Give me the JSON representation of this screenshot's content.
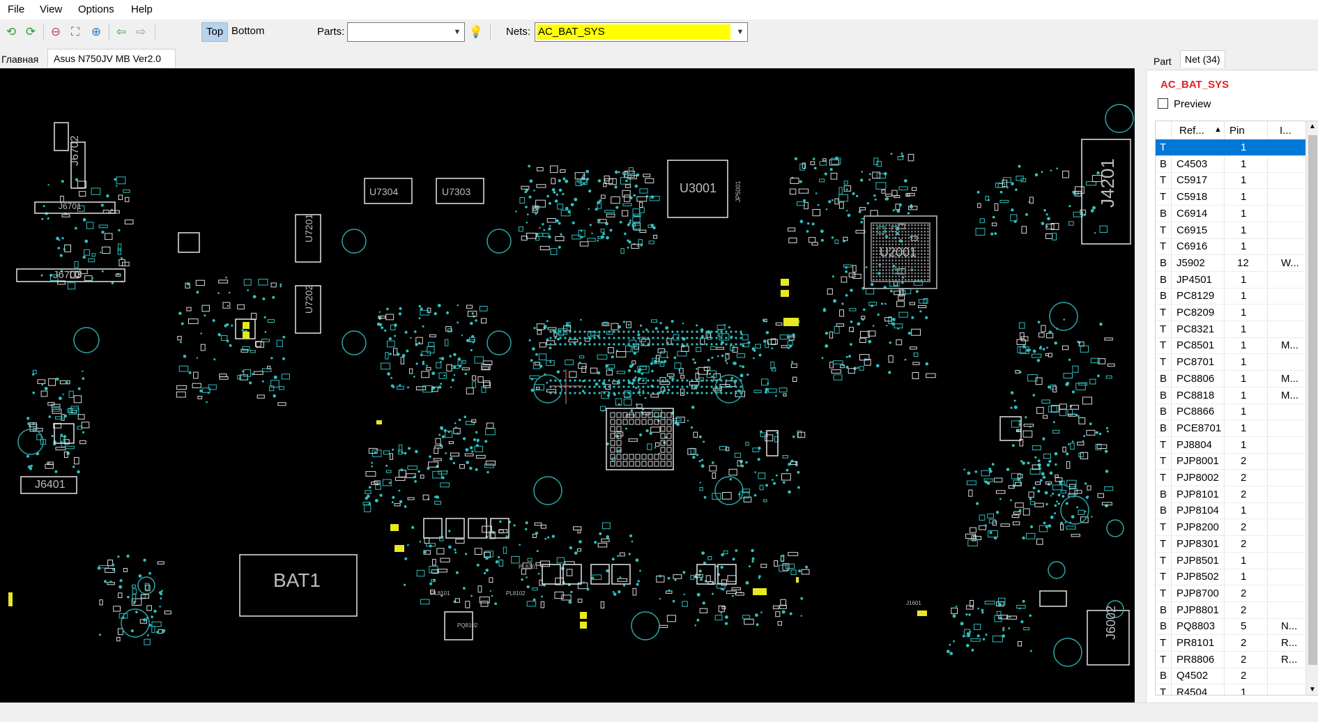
{
  "menu": {
    "items": [
      "File",
      "View",
      "Options",
      "Help"
    ]
  },
  "toolbar": {
    "layers": {
      "top": "Top",
      "bottom": "Bottom",
      "active": "Top"
    },
    "parts_label": "Parts:",
    "parts_value": "",
    "nets_label": "Nets:",
    "nets_value": "AC_BAT_SYS",
    "nets_highlight": "#ffff00"
  },
  "doc_tabs": [
    "Главная",
    "Asus N750JV MB Ver2.0"
  ],
  "board": {
    "labels": [
      "J6702",
      "J6701",
      "J6703",
      "J6401",
      "U7304",
      "U7303",
      "U7201",
      "U7202",
      "U3001",
      "U2001",
      "J4201",
      "BAT1",
      "J6002",
      "JP5001",
      "J1601",
      "PL8101",
      "PL8102",
      "PQ8102",
      "PL8201"
    ],
    "trace_color": "#30c0c0",
    "highlight_color": "#e8e820"
  },
  "panel": {
    "tabs": [
      "Part",
      "Net (34)"
    ],
    "active_tab": "Net (34)",
    "net_title": "AC_BAT_SYS",
    "preview_label": "Preview",
    "columns": [
      "Ref...",
      "Pin",
      "I..."
    ],
    "rows": [
      {
        "side": "T",
        "ref": "",
        "pin": "1",
        "info": ""
      },
      {
        "side": "B",
        "ref": "C4503",
        "pin": "1",
        "info": ""
      },
      {
        "side": "T",
        "ref": "C5917",
        "pin": "1",
        "info": ""
      },
      {
        "side": "T",
        "ref": "C5918",
        "pin": "1",
        "info": ""
      },
      {
        "side": "B",
        "ref": "C6914",
        "pin": "1",
        "info": ""
      },
      {
        "side": "T",
        "ref": "C6915",
        "pin": "1",
        "info": ""
      },
      {
        "side": "T",
        "ref": "C6916",
        "pin": "1",
        "info": ""
      },
      {
        "side": "B",
        "ref": "J5902",
        "pin": "12",
        "info": "W..."
      },
      {
        "side": "B",
        "ref": "JP4501",
        "pin": "1",
        "info": ""
      },
      {
        "side": "B",
        "ref": "PC8129",
        "pin": "1",
        "info": ""
      },
      {
        "side": "T",
        "ref": "PC8209",
        "pin": "1",
        "info": ""
      },
      {
        "side": "T",
        "ref": "PC8321",
        "pin": "1",
        "info": ""
      },
      {
        "side": "T",
        "ref": "PC8501",
        "pin": "1",
        "info": "M..."
      },
      {
        "side": "T",
        "ref": "PC8701",
        "pin": "1",
        "info": ""
      },
      {
        "side": "B",
        "ref": "PC8806",
        "pin": "1",
        "info": "M..."
      },
      {
        "side": "B",
        "ref": "PC8818",
        "pin": "1",
        "info": "M..."
      },
      {
        "side": "B",
        "ref": "PC8866",
        "pin": "1",
        "info": ""
      },
      {
        "side": "B",
        "ref": "PCE8701",
        "pin": "1",
        "info": ""
      },
      {
        "side": "T",
        "ref": "PJ8804",
        "pin": "1",
        "info": ""
      },
      {
        "side": "T",
        "ref": "PJP8001",
        "pin": "2",
        "info": ""
      },
      {
        "side": "T",
        "ref": "PJP8002",
        "pin": "2",
        "info": ""
      },
      {
        "side": "B",
        "ref": "PJP8101",
        "pin": "2",
        "info": ""
      },
      {
        "side": "B",
        "ref": "PJP8104",
        "pin": "1",
        "info": ""
      },
      {
        "side": "T",
        "ref": "PJP8200",
        "pin": "2",
        "info": ""
      },
      {
        "side": "T",
        "ref": "PJP8301",
        "pin": "2",
        "info": ""
      },
      {
        "side": "T",
        "ref": "PJP8501",
        "pin": "1",
        "info": ""
      },
      {
        "side": "T",
        "ref": "PJP8502",
        "pin": "1",
        "info": ""
      },
      {
        "side": "T",
        "ref": "PJP8700",
        "pin": "2",
        "info": ""
      },
      {
        "side": "B",
        "ref": "PJP8801",
        "pin": "2",
        "info": ""
      },
      {
        "side": "B",
        "ref": "PQ8803",
        "pin": "5",
        "info": "N..."
      },
      {
        "side": "T",
        "ref": "PR8101",
        "pin": "2",
        "info": "R..."
      },
      {
        "side": "T",
        "ref": "PR8806",
        "pin": "2",
        "info": "R..."
      },
      {
        "side": "B",
        "ref": "Q4502",
        "pin": "2",
        "info": ""
      },
      {
        "side": "T",
        "ref": "R4504",
        "pin": "1",
        "info": ""
      }
    ],
    "selected_row": 0,
    "selection_color": "#0078d7"
  }
}
